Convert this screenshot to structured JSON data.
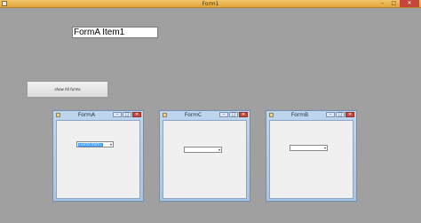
{
  "main_window": {
    "title": "Form1",
    "minimize_glyph": "–",
    "maximize_glyph": "□",
    "close_glyph": "✕"
  },
  "label": {
    "text": "FormA Item1"
  },
  "show_button": {
    "label": "show All forms"
  },
  "child_forms": [
    {
      "title": "FormA",
      "combo_value": "FormA Item1"
    },
    {
      "title": "FormC",
      "combo_value": ""
    },
    {
      "title": "FormB",
      "combo_value": ""
    }
  ],
  "child_buttons": {
    "minimize": "–",
    "maximize": "□",
    "close": "✕"
  },
  "combo_arrow": "▾",
  "colors": {
    "desktop": "#a0a0a0",
    "main_titlebar": "#e2a53c",
    "child_frame": "#a9c5e4",
    "selection": "#3399ff",
    "close_button": "#c8453a"
  }
}
